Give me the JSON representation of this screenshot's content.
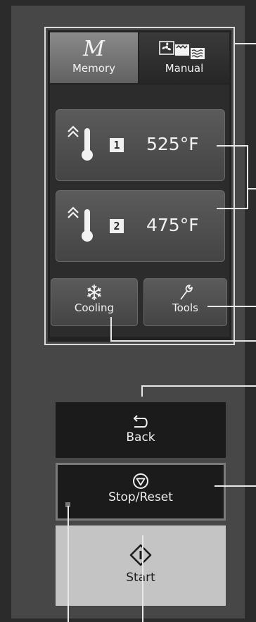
{
  "tabs": {
    "memory": {
      "symbol": "M",
      "label": "Memory"
    },
    "manual": {
      "label": "Manual"
    }
  },
  "zones": [
    {
      "number": "1",
      "temperature": "525°F"
    },
    {
      "number": "2",
      "temperature": "475°F"
    }
  ],
  "functions": {
    "cooling": "Cooling",
    "tools": "Tools"
  },
  "controls": {
    "back": "Back",
    "stop_reset": "Stop/Reset",
    "start": "Start"
  },
  "colors": {
    "panel": "#474747",
    "screen": "#222222",
    "start_button": "#c4c4c4",
    "frame": "#dcdcdc"
  }
}
